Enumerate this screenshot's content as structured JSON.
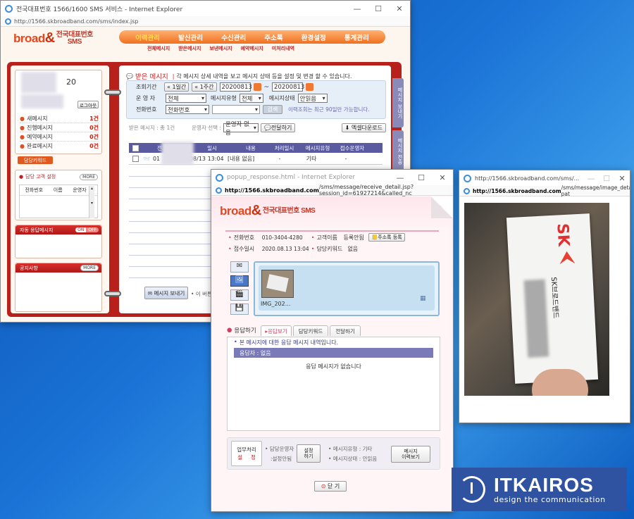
{
  "main_window": {
    "title": "전국대표번호 1566/1600 SMS 서비스 - Internet Explorer",
    "url_host": "http://1566.skbroadband.com",
    "url_path": "/sms/index.jsp"
  },
  "brand": {
    "logo_text": "broad",
    "logo_sub1": "전국대표번호",
    "logo_sub2": "SMS"
  },
  "nav": {
    "items": [
      "이력관리",
      "발신관리",
      "수신관리",
      "주소록",
      "환경설정",
      "통계관리"
    ],
    "sub": [
      "전체메시지",
      "받은메시지",
      "보낸메시지",
      "예약메시지",
      "미처리내역"
    ]
  },
  "side": {
    "count_prefix": "20",
    "logout": "로그아웃",
    "messages": [
      {
        "label": "새메시지",
        "count": "1건"
      },
      {
        "label": "진행메시지",
        "count": "0건"
      },
      {
        "label": "예약메시지",
        "count": "0건"
      },
      {
        "label": "완료메시지",
        "count": "0건"
      }
    ],
    "keyword_btn": "담당키워드",
    "agent_title": "담당 고객 설정",
    "more": "MORE",
    "agent_cols": [
      "전화번호",
      "이름",
      "운영자"
    ],
    "auto_reply": "자동 응답메시지",
    "on": "ON",
    "off": "OFF",
    "notice": "공지사항"
  },
  "received": {
    "title": "받은 메시지",
    "desc": "각 메시지 상세 내역을 보고 메시지 상태 등을 설정 및 변경 할 수 있습니다.",
    "period_label": "조회기간",
    "btn_1day": "1일간",
    "btn_1week": "1주간",
    "date_from": "20200813",
    "date_to": "20200813",
    "operator_label": "운 영 자",
    "operator_value": "전체",
    "type_label": "메시지유형",
    "type_value": "전체",
    "state_label": "메시지상태",
    "state_value": "안읽음",
    "phone_label": "전화번호",
    "phone_value": "전화번호",
    "search_btn": "검색",
    "search_note": "이력조회는 최근 90일만 가능합니다.",
    "total": "받은 메시지 : 총 1건",
    "op_select": "운영자 선택 :",
    "op_none": "운영자 없음",
    "forward_btn": "전달하기",
    "excel_btn": "엑셀다운로드",
    "cols": [
      "전",
      "일시",
      "내용",
      "처리일시",
      "메시지유형",
      "접수운영자"
    ],
    "rows": [
      {
        "phone": "01",
        "time": "08/13 13:04",
        "content": "[내용 없음]",
        "processed": "-",
        "type": "기타",
        "operator": "-"
      }
    ],
    "send_btn": "메시지 보내기",
    "footnote": "• 이 버튼"
  },
  "right_tabs": [
    "메시지 보내기",
    "메시지 전송"
  ],
  "popup": {
    "title": "popup_response.html - Internet Explorer",
    "url_host": "http://1566.skbroadband.com",
    "url_path": "/sms/message/receive_detail.jsp?session_id=61927214&called_nc",
    "logo_sub": "전국대표번호 SMS",
    "phone_label": "전화번호",
    "phone_value": "010-3404-4280",
    "customer_label": "고객이름",
    "customer_value": "등록안됨",
    "addr_btn": "주소록 등록",
    "time_label": "접수일시",
    "time_value": "2020.08.13 13:04",
    "kw_label": "담당키워드",
    "kw_value": "없음",
    "attachment": "IMG_202...",
    "reply_title": "응답하기",
    "tabs": [
      "응답보기",
      "담당키워드",
      "전달하기"
    ],
    "reply_desc": "본 메시지에 대한 응답 메시지 내역입니다.",
    "responder": "응답자 : 없음",
    "no_reply": "응답 메시지가 없습니다",
    "biz_btn1": "업무처리",
    "biz_btn2": "설     정",
    "assignee_label": "담당운영자",
    "assignee_value": ":설정안됨",
    "setting_btn1": "설정",
    "setting_btn2": "하기",
    "type_label": "메시지유형 : 기타",
    "state_label": "메시지상태 : 안읽음",
    "history_btn1": "메시지",
    "history_btn2": "이력보기",
    "close_btn": "닫 기"
  },
  "image_window": {
    "title": "http://1566.skbroadband.com/sms/...",
    "url_host": "http://1566.skbroadband.com",
    "url_path": "/sms/message/image_detail.jsp?pat",
    "card_brand": "SK",
    "card_text": "SK브로드밴드"
  },
  "watermark": {
    "name": "ITKAIROS",
    "slogan": "design the communication"
  },
  "colors": {
    "brand_orange": "#f07020",
    "red": "#c0201c",
    "navy_header": "#5a5aa0"
  }
}
